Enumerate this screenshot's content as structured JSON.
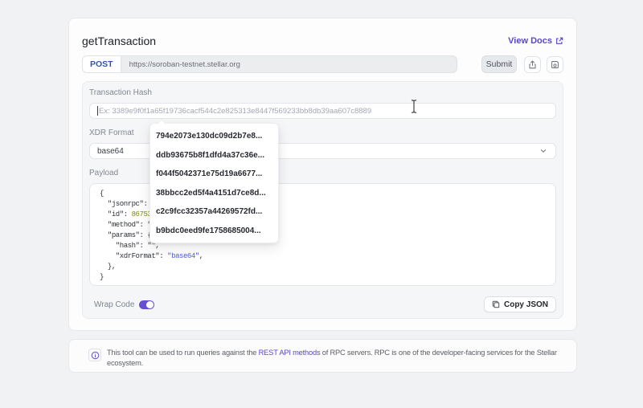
{
  "header": {
    "title": "getTransaction",
    "view_docs_label": "View Docs"
  },
  "request": {
    "method": "POST",
    "url": "https://soroban-testnet.stellar.org",
    "submit_label": "Submit"
  },
  "form": {
    "hash_label": "Transaction Hash",
    "hash_placeholder": "Ex: 3389e9f0f1a65f19736cacf544c2e825313e8447f569233bb8db39aa607c8889",
    "xdr_label": "XDR Format",
    "xdr_value": "base64",
    "payload_label": "Payload",
    "wrap_code_label": "Wrap Code",
    "wrap_code_on": true,
    "copy_json_label": "Copy JSON"
  },
  "payload": {
    "lines": [
      [
        {
          "t": "{"
        }
      ],
      [
        {
          "t": "  \"jsonrpc\": "
        }
      ],
      [
        {
          "t": "  \"id\": "
        },
        {
          "t": "86753",
          "c": "num"
        }
      ],
      [
        {
          "t": "  \"method\": \""
        }
      ],
      [
        {
          "t": "  \"params\": {"
        }
      ],
      [
        {
          "t": "    \"hash\": \"\","
        }
      ],
      [
        {
          "t": "    \"xdrFormat\": "
        },
        {
          "t": "\"base64\"",
          "c": "str"
        },
        {
          "t": ","
        }
      ],
      [
        {
          "t": "  },"
        }
      ],
      [
        {
          "t": "}"
        }
      ]
    ]
  },
  "dropdown": {
    "items": [
      "794e2073e130dc09d2b7e8...",
      "ddb93675b8f1dfd4a37c36e...",
      "f044f5042371e75d19a6677...",
      "38bbcc2ed5f4a4151d7ce8d...",
      "c2c9fcc32357a44269572fd...",
      "b9bdc0eed9fe1758685004..."
    ]
  },
  "info": {
    "text_before": "This tool can be used to run queries against the ",
    "link_text": "REST API methods",
    "text_after": " of RPC servers. RPC is one of the developer-facing services for the Stellar ecosystem."
  },
  "colors": {
    "accent_link": "#5847cb",
    "post_method": "#3452b4",
    "toggle_on": "#6550d2",
    "code_number": "#7d8c00",
    "code_string": "#4a5bd0"
  }
}
